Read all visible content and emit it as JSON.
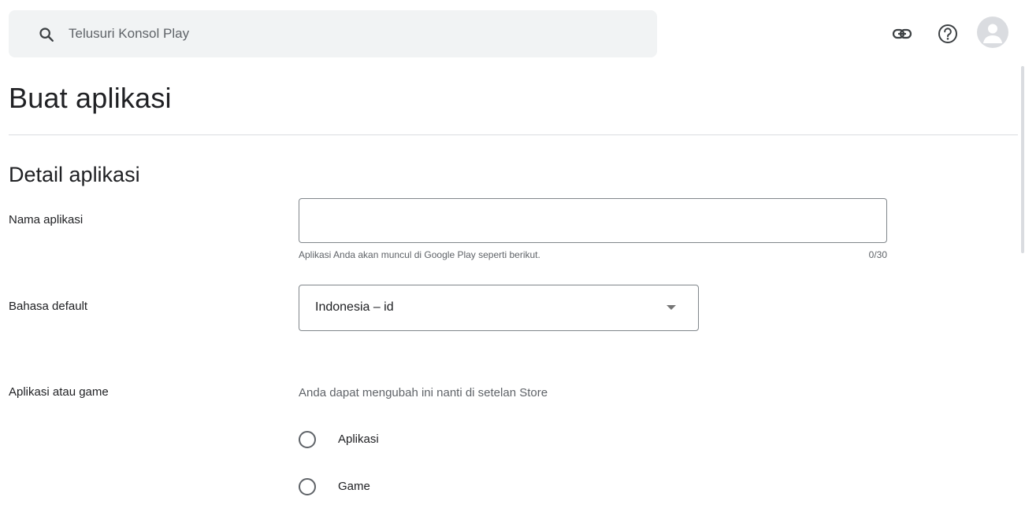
{
  "search": {
    "placeholder": "Telusuri Konsol Play"
  },
  "header": {
    "icons": [
      "link-icon",
      "help-icon",
      "avatar-icon"
    ]
  },
  "page": {
    "title": "Buat aplikasi"
  },
  "section": {
    "title": "Detail aplikasi"
  },
  "app_name": {
    "label": "Nama aplikasi",
    "value": "",
    "helper": "Aplikasi Anda akan muncul di Google Play seperti berikut.",
    "counter": "0/30"
  },
  "default_language": {
    "label": "Bahasa default",
    "value": "Indonesia – id"
  },
  "app_or_game": {
    "label": "Aplikasi atau game",
    "hint": "Anda dapat mengubah ini nanti di setelan Store",
    "options": [
      {
        "label": "Aplikasi",
        "selected": false
      },
      {
        "label": "Game",
        "selected": false
      }
    ]
  },
  "colors": {
    "search_bg": "#f1f3f4",
    "border": "#80868b",
    "divider": "#dadce0",
    "text_primary": "#202124",
    "text_secondary": "#5f6368"
  }
}
